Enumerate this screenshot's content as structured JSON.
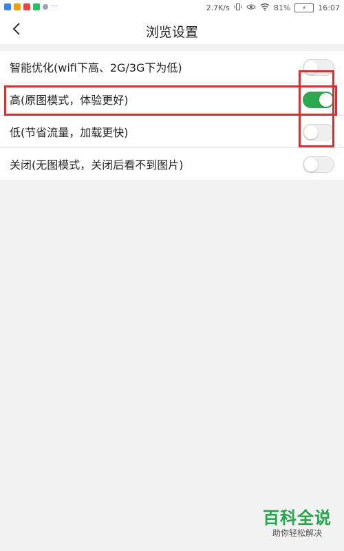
{
  "status_bar": {
    "speed": "2.7K/s",
    "battery": "81%",
    "time": "16:07"
  },
  "header": {
    "title": "浏览设置"
  },
  "settings": {
    "items": [
      {
        "label": "智能优化(wifi下高、2G/3G下为低)",
        "enabled": false
      },
      {
        "label": "高(原图模式，体验更好)",
        "enabled": true
      },
      {
        "label": "低(节省流量，加载更快)",
        "enabled": false
      },
      {
        "label": "关闭(无图模式，关闭后看不到图片)",
        "enabled": false
      }
    ]
  },
  "watermark": {
    "brand": "百科全说",
    "subtitle": "助你轻松解决"
  },
  "colors": {
    "toggle_on": "#2ea84f",
    "annotation": "#e32b2b",
    "watermark_brand": "#1ea84a"
  }
}
